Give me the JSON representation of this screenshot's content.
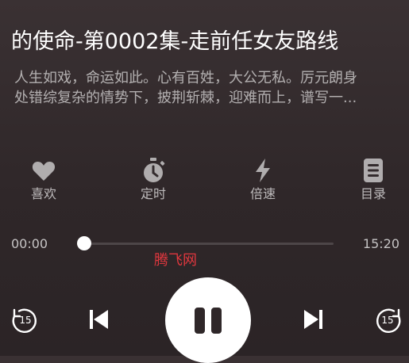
{
  "header": {
    "title": "的使命-第0002集-走前任女友路线"
  },
  "description": {
    "line1": "人生如戏，命运如此。心有百姓，大公无私。厉元朗身",
    "line2": "处错综复杂的情势下，披荆斩棘，迎难而上，谱写一..."
  },
  "actions": [
    {
      "label": "喜欢",
      "icon": "heart-icon"
    },
    {
      "label": "定时",
      "icon": "stopwatch-icon"
    },
    {
      "label": "倍速",
      "icon": "lightning-icon"
    },
    {
      "label": "目录",
      "icon": "list-icon"
    }
  ],
  "player": {
    "current_time": "00:00",
    "total_time": "15:20",
    "progress": 0,
    "skip_seconds": "15"
  },
  "watermark": {
    "text": "腾飞网"
  },
  "colors": {
    "background": "#2f2729",
    "accent": "#ffffff",
    "watermark": "#e0373e"
  }
}
